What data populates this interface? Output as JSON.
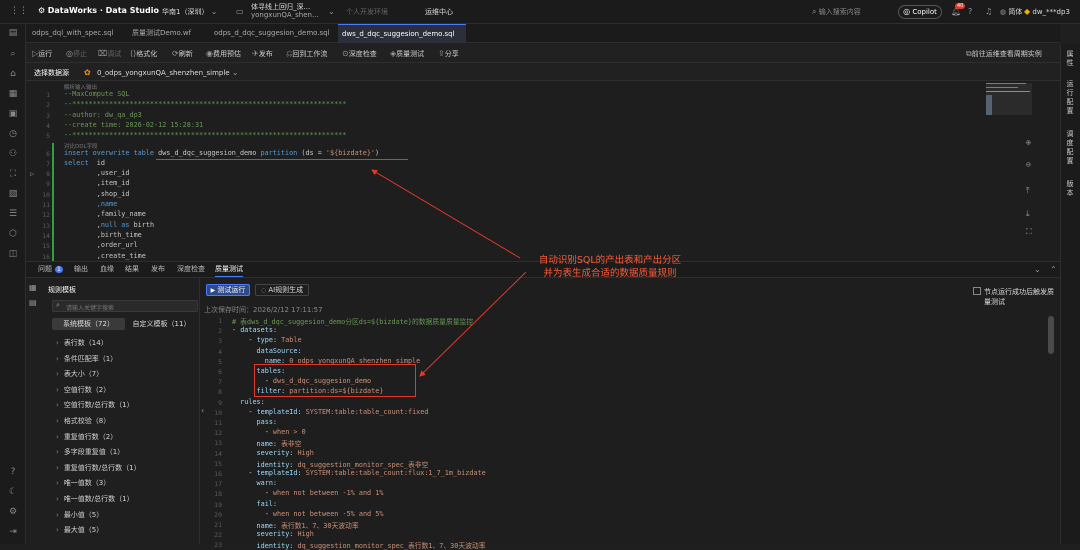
{
  "topbar": {
    "logo_text": "DataWorks · Data Studio",
    "region": "华南1（深圳）",
    "workspace_title": "体寻线上回归_深...",
    "workspace_sub": "yongxunQA_shen...",
    "env": "个人开发环境",
    "ops_center": "运维中心",
    "search_placeholder": "输入搜索内容",
    "copilot": "Copilot",
    "badge": "40",
    "lang": "简体",
    "user": "dw_***dp3"
  },
  "tabs": [
    {
      "label": "odps_dql_with_spec.sql"
    },
    {
      "label": "质量测试Demo.wf"
    },
    {
      "label": "odps_d_dqc_suggesion_demo.sql"
    },
    {
      "label": "dws_d_dqc_suggesion_demo.sql"
    }
  ],
  "toolbar": {
    "run": "运行",
    "stop": "停止",
    "debug": "调试",
    "format": "格式化",
    "refresh": "刷新",
    "cost": "费用预估",
    "publish": "发布",
    "back_wf": "回到工作流",
    "deep_check": "深度检查",
    "quality_test": "质量测试",
    "share": "分享",
    "goto_ops": "前往运维查看周期实例"
  },
  "dsbar": {
    "label": "选择数据源",
    "value": "0_odps_yongxunQA_shenzhen_simple"
  },
  "editor": {
    "lines": [
      {
        "n": "",
        "tokens": [
          [
            "c-hint",
            "解析输入输出"
          ]
        ]
      },
      {
        "n": "1",
        "tokens": [
          [
            "c-green",
            "--MaxCompute SQL"
          ]
        ]
      },
      {
        "n": "2",
        "tokens": [
          [
            "c-green",
            "--*******************************************************************"
          ]
        ]
      },
      {
        "n": "3",
        "tokens": [
          [
            "c-green",
            "--author: dw_qa_dp3"
          ]
        ]
      },
      {
        "n": "4",
        "tokens": [
          [
            "c-green",
            "--create time: 2026-02-12 15:28:31"
          ]
        ]
      },
      {
        "n": "5",
        "tokens": [
          [
            "c-green",
            "--*******************************************************************"
          ]
        ]
      },
      {
        "n": "",
        "tokens": [
          [
            "c-hint",
            "对比DDL字段"
          ]
        ]
      },
      {
        "n": "6",
        "tokens": [
          [
            "c-kw",
            "insert overwrite table "
          ],
          [
            "c-id",
            "dws_d_dqc_suggesion_demo "
          ],
          [
            "c-kw",
            "partition "
          ],
          [
            "c-id",
            "(ds = "
          ],
          [
            "c-str",
            "'${bizdate}'"
          ],
          [
            "c-id",
            ")"
          ]
        ]
      },
      {
        "n": "7",
        "tokens": [
          [
            "c-kw",
            "select  "
          ],
          [
            "c-id",
            "id"
          ]
        ]
      },
      {
        "n": "8",
        "tokens": [
          [
            "c-id",
            "        ,user_id"
          ]
        ]
      },
      {
        "n": "9",
        "tokens": [
          [
            "c-id",
            "        ,item_id"
          ]
        ]
      },
      {
        "n": "10",
        "tokens": [
          [
            "c-id",
            "        ,shop_id"
          ]
        ]
      },
      {
        "n": "11",
        "tokens": [
          [
            "c-kw",
            "        ,name"
          ]
        ]
      },
      {
        "n": "12",
        "tokens": [
          [
            "c-id",
            "        ,family_name"
          ]
        ]
      },
      {
        "n": "13",
        "tokens": [
          [
            "c-id",
            "        ,"
          ],
          [
            "c-kw",
            "null as "
          ],
          [
            "c-id",
            "birth"
          ]
        ]
      },
      {
        "n": "14",
        "tokens": [
          [
            "c-id",
            "        ,birth_time"
          ]
        ]
      },
      {
        "n": "15",
        "tokens": [
          [
            "c-id",
            "        ,order_url"
          ]
        ]
      },
      {
        "n": "16",
        "tokens": [
          [
            "c-id",
            "        ,create_time"
          ]
        ]
      }
    ]
  },
  "bottom_tabs": {
    "problems": "问题",
    "problems_count": "1",
    "output": "输出",
    "lineage": "血缘",
    "result": "结果",
    "publish": "发布",
    "deep_check": "深度检查",
    "quality_test": "质量测试"
  },
  "rules_panel": {
    "title": "规则模板",
    "search_placeholder": "请输入关键字搜索",
    "tab_system": "系统模板（72）",
    "tab_custom": "自定义模板（11）",
    "items": [
      "表行数（14）",
      "条件匹配率（1）",
      "表大小（7）",
      "空值行数（2）",
      "空值行数/总行数（1）",
      "格式校验（8）",
      "重复值行数（2）",
      "多字段重复值（1）",
      "重复值行数/总行数（1）",
      "唯一值数（3）",
      "唯一值数/总行数（1）",
      "最小值（5）",
      "最大值（5）"
    ]
  },
  "quality": {
    "test_run": "测试运行",
    "ai_gen": "AI规则生成",
    "trigger_label": "节点运行成功后触发质量测试",
    "last_saved": "上次保存时间：2026/2/12 17:11:57",
    "lines": [
      {
        "n": "1",
        "t": [
          [
            "ycom",
            "# 表dws_d_dqc_suggesion_demo分区ds=${bizdate}的数据质量质量监控"
          ]
        ]
      },
      {
        "n": "2",
        "t": [
          [
            "ydash",
            "- "
          ],
          [
            "ytk",
            "datasets"
          ],
          [
            "ydash",
            ":"
          ]
        ]
      },
      {
        "n": "3",
        "t": [
          [
            "ydash",
            "    - "
          ],
          [
            "ytk",
            "type"
          ],
          [
            "ydash",
            ": "
          ],
          [
            "yval",
            "Table"
          ]
        ]
      },
      {
        "n": "4",
        "t": [
          [
            "ytk",
            "      dataSource"
          ],
          [
            "ydash",
            ":"
          ]
        ]
      },
      {
        "n": "5",
        "t": [
          [
            "ytk",
            "        name"
          ],
          [
            "ydash",
            ": "
          ],
          [
            "yval",
            "0_odps_yongxunQA_shenzhen_simple"
          ]
        ]
      },
      {
        "n": "6",
        "t": [
          [
            "ytk",
            "      tables"
          ],
          [
            "ydash",
            ":"
          ]
        ]
      },
      {
        "n": "7",
        "t": [
          [
            "ydash",
            "        - "
          ],
          [
            "yval",
            "dws_d_dqc_suggesion_demo"
          ]
        ]
      },
      {
        "n": "8",
        "t": [
          [
            "ytk",
            "      filter"
          ],
          [
            "ydash",
            ": "
          ],
          [
            "yval",
            "partition:ds=${bizdate}"
          ]
        ]
      },
      {
        "n": "9",
        "t": [
          [
            "ytk",
            "  rules"
          ],
          [
            "ydash",
            ":"
          ]
        ]
      },
      {
        "n": "10",
        "t": [
          [
            "ydash",
            "    - "
          ],
          [
            "ytk",
            "templateId"
          ],
          [
            "ydash",
            ": "
          ],
          [
            "yval",
            "SYSTEM:table:table_count:fixed"
          ]
        ]
      },
      {
        "n": "11",
        "t": [
          [
            "ytk",
            "      pass"
          ],
          [
            "ydash",
            ":"
          ]
        ]
      },
      {
        "n": "12",
        "t": [
          [
            "ydash",
            "        - "
          ],
          [
            "yval",
            "when > 0"
          ]
        ]
      },
      {
        "n": "13",
        "t": [
          [
            "ytk",
            "      name"
          ],
          [
            "ydash",
            ": "
          ],
          [
            "yval",
            "表非空"
          ]
        ]
      },
      {
        "n": "14",
        "t": [
          [
            "ytk",
            "      severity"
          ],
          [
            "ydash",
            ": "
          ],
          [
            "yval",
            "High"
          ]
        ]
      },
      {
        "n": "15",
        "t": [
          [
            "ytk",
            "      identity"
          ],
          [
            "ydash",
            ": "
          ],
          [
            "yval",
            "dq_suggestion_monitor_spec_表非空"
          ]
        ]
      },
      {
        "n": "16",
        "t": [
          [
            "ydash",
            "    - "
          ],
          [
            "ytk",
            "templateId"
          ],
          [
            "ydash",
            ": "
          ],
          [
            "yval",
            "SYSTEM:table:table_count:flux:1_7_1m_bizdate"
          ]
        ]
      },
      {
        "n": "17",
        "t": [
          [
            "ytk",
            "      warn"
          ],
          [
            "ydash",
            ":"
          ]
        ]
      },
      {
        "n": "18",
        "t": [
          [
            "ydash",
            "        - "
          ],
          [
            "yval",
            "when not between -1% and 1%"
          ]
        ]
      },
      {
        "n": "19",
        "t": [
          [
            "ytk",
            "      fail"
          ],
          [
            "ydash",
            ":"
          ]
        ]
      },
      {
        "n": "20",
        "t": [
          [
            "ydash",
            "        - "
          ],
          [
            "yval",
            "when not between -5% and 5%"
          ]
        ]
      },
      {
        "n": "21",
        "t": [
          [
            "ytk",
            "      name"
          ],
          [
            "ydash",
            ": "
          ],
          [
            "yval",
            "表行数1、7、30天波动率"
          ]
        ]
      },
      {
        "n": "22",
        "t": [
          [
            "ytk",
            "      severity"
          ],
          [
            "ydash",
            ": "
          ],
          [
            "yval",
            "High"
          ]
        ]
      },
      {
        "n": "23",
        "t": [
          [
            "ytk",
            "      identity"
          ],
          [
            "ydash",
            ": "
          ],
          [
            "yval",
            "dq_suggestion_monitor_spec_表行数1、7、30天波动率"
          ]
        ]
      }
    ]
  },
  "annotation": {
    "line1": "自动识别SQL的产出表和产出分区",
    "line2": "并为表生成合适的数据质量规则"
  },
  "right_panel": {
    "attr": "属性",
    "run_cfg": "运行配置",
    "sched_cfg": "调度配置",
    "version": "版本"
  },
  "colors": {
    "accent": "#4a7bff",
    "annotation": "#e0392b",
    "bg": "#1e1e1e"
  }
}
